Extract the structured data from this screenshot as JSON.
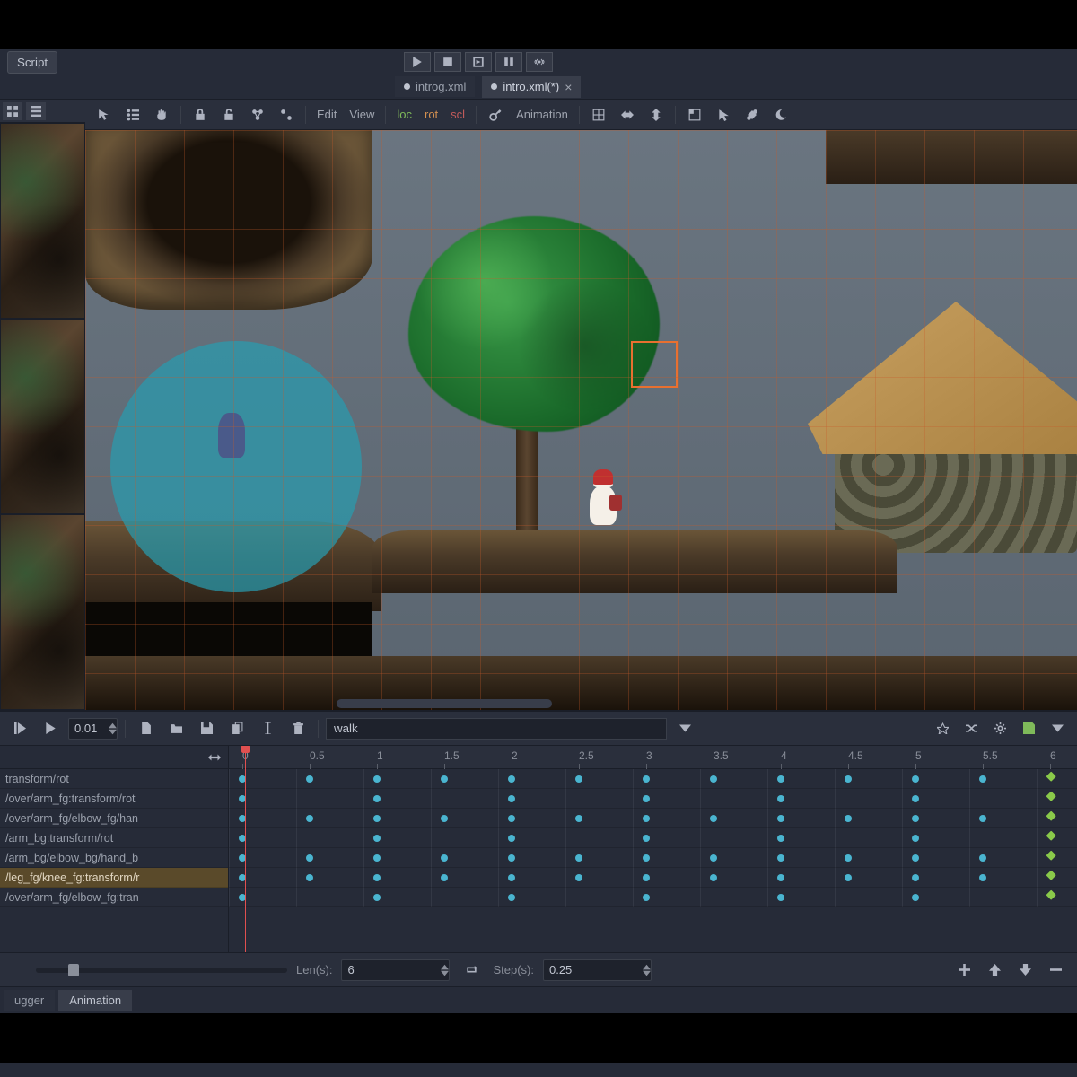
{
  "top": {
    "script": "Script"
  },
  "tabs": [
    {
      "name": "introg.xml",
      "modified": false
    },
    {
      "name": "intro.xml(*)",
      "modified": true
    }
  ],
  "toolbar": {
    "edit": "Edit",
    "view": "View",
    "loc": "loc",
    "rot": "rot",
    "scl": "scl",
    "animation": "Animation"
  },
  "anim": {
    "time": "0.01",
    "name": "walk",
    "len_label": "Len(s):",
    "len_value": "6",
    "step_label": "Step(s):",
    "step_value": "0.25"
  },
  "ruler": [
    "0",
    "0.5",
    "1",
    "1.5",
    "2",
    "2.5",
    "3",
    "3.5",
    "4",
    "4.5",
    "5",
    "5.5",
    "6"
  ],
  "tracks": [
    {
      "name": "transform/rot",
      "keys": [
        0,
        0.5,
        1,
        1.5,
        2,
        2.5,
        3,
        3.5,
        4,
        4.5,
        5,
        5.5
      ],
      "end": 6
    },
    {
      "name": "/over/arm_fg:transform/rot",
      "keys": [
        0,
        1,
        2,
        3,
        4,
        5
      ],
      "end": 6
    },
    {
      "name": "/over/arm_fg/elbow_fg/han",
      "keys": [
        0,
        0.5,
        1,
        1.5,
        2,
        2.5,
        3,
        3.5,
        4,
        4.5,
        5,
        5.5
      ],
      "end": 6
    },
    {
      "name": "/arm_bg:transform/rot",
      "keys": [
        0,
        1,
        2,
        3,
        4,
        5
      ],
      "end": 6
    },
    {
      "name": "/arm_bg/elbow_bg/hand_b",
      "keys": [
        0,
        0.5,
        1,
        1.5,
        2,
        2.5,
        3,
        3.5,
        4,
        4.5,
        5,
        5.5
      ],
      "end": 6
    },
    {
      "name": "/leg_fg/knee_fg:transform/r",
      "keys": [
        0,
        0.5,
        1,
        1.5,
        2,
        2.5,
        3,
        3.5,
        4,
        4.5,
        5,
        5.5
      ],
      "end": 6,
      "sel": true
    },
    {
      "name": "/over/arm_fg/elbow_fg:tran",
      "keys": [
        0,
        1,
        2,
        3,
        4,
        5
      ],
      "end": 6
    }
  ],
  "bottom_tabs": {
    "debugger": "ugger",
    "animation": "Animation"
  }
}
